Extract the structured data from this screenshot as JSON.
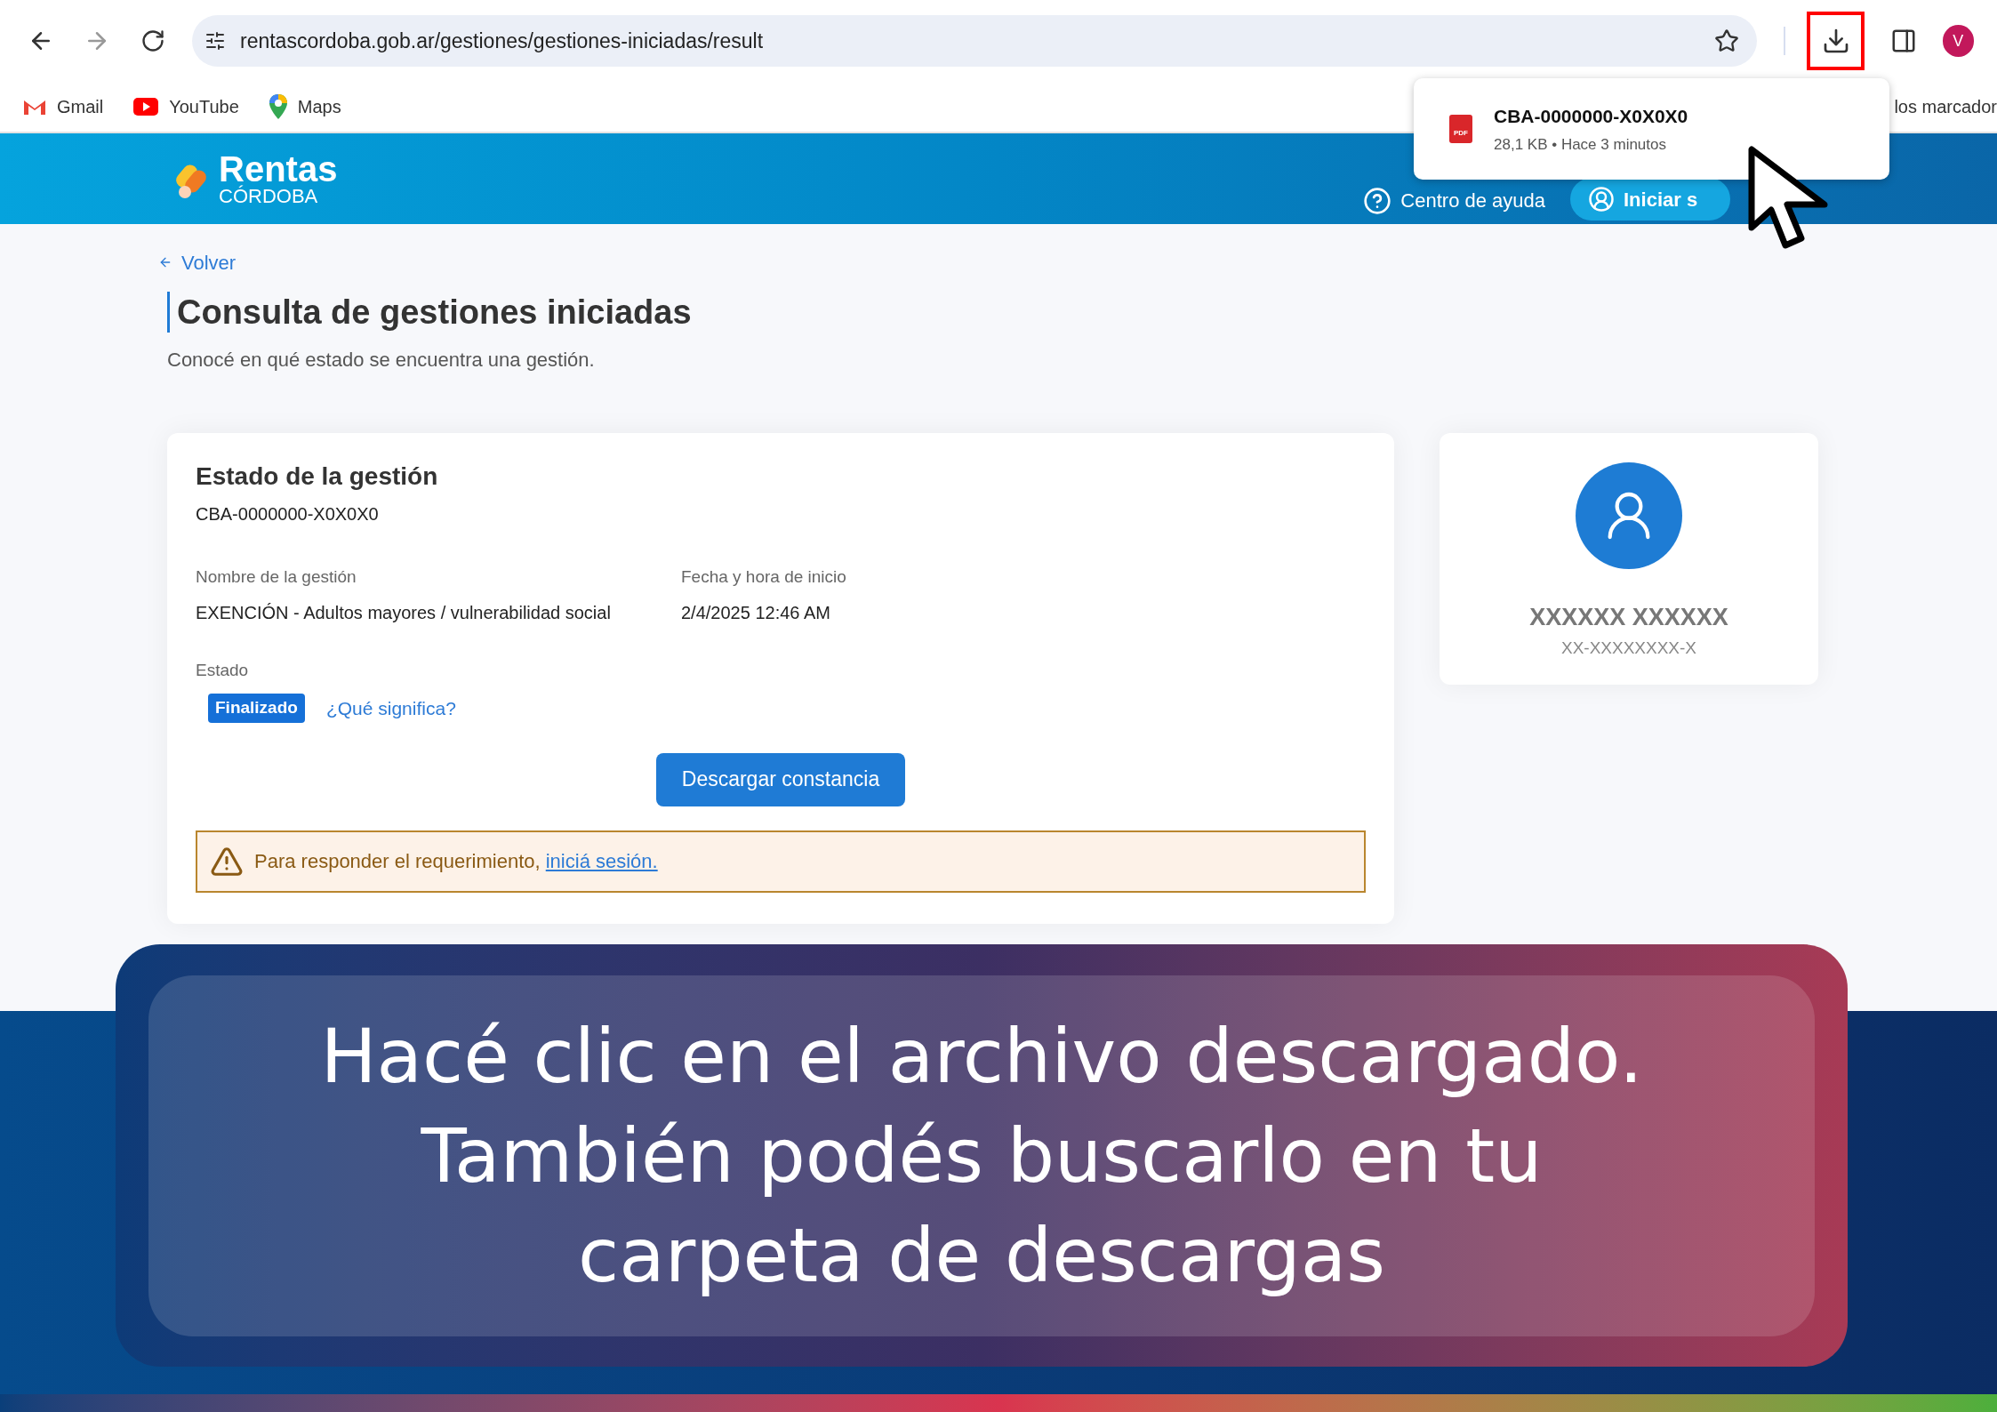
{
  "browser": {
    "url": "rentascordoba.gob.ar/gestiones/gestiones-iniciadas/result",
    "download_button": {
      "highlighted": true
    },
    "profile_initial": "V"
  },
  "bookmarks": [
    {
      "kind": "gmail",
      "label": "Gmail"
    },
    {
      "kind": "youtube",
      "label": "YouTube"
    },
    {
      "kind": "maps",
      "label": "Maps"
    }
  ],
  "bookmarks_overflow": "los marcador",
  "downloads_popup": {
    "file_type_badge": "PDF",
    "file_name": "CBA-0000000-X0X0X0",
    "details": "28,1 KB • Hace 3 minutos"
  },
  "site_header": {
    "logo_title": "Rentas",
    "logo_subtitle": "CÓRDOBA",
    "help_link": "Centro de ayuda",
    "login_button": "Iniciar s"
  },
  "page": {
    "back_link": "Volver",
    "title": "Consulta de gestiones iniciadas",
    "subtitle": "Conocé en qué estado se encuentra una gestión."
  },
  "status_card": {
    "title": "Estado de la gestión",
    "code": "CBA-0000000-X0X0X0",
    "fields": [
      {
        "label": "Nombre de la gestión",
        "value": "EXENCIÓN - Adultos mayores / vulnerabilidad social"
      },
      {
        "label": "Fecha y hora de inicio",
        "value": "2/4/2025 12:46 AM"
      }
    ],
    "status_label": "Estado",
    "status_badge": "Finalizado",
    "status_help_link": "¿Qué significa?",
    "download_button": "Descargar constancia",
    "alert": {
      "text": "Para responder el requerimiento, ",
      "link": "iniciá sesión."
    }
  },
  "user_card": {
    "name": "XXXXXX XXXXXX",
    "id": "XX-XXXXXXXX-X"
  },
  "caption": {
    "lines": [
      "Hacé clic en el archivo descargado.",
      "También podés buscarlo en tu",
      "carpeta de descargas"
    ]
  }
}
